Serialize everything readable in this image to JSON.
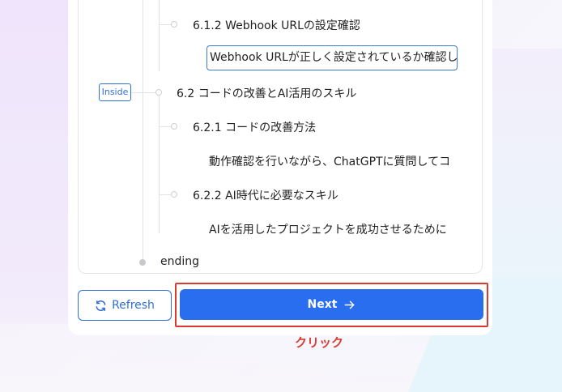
{
  "tree": {
    "nodes": [
      {
        "id": "6-1-2",
        "label": "6.1.2 Webhook URLの設定確認"
      },
      {
        "id": "6-2",
        "label": "6.2 コードの改善とAI活用のスキル"
      },
      {
        "id": "6-2-1",
        "label": "6.2.1 コードの改善方法"
      },
      {
        "id": "6-2-2",
        "label": "6.2.2 AI時代に必要なスキル"
      },
      {
        "id": "ending",
        "label": "ending"
      }
    ],
    "texts": [
      {
        "id": "6-1-2-text",
        "value": "Webhook URLが正しく設定されているか確認し"
      },
      {
        "id": "6-2-1-text",
        "value": "動作確認を行いながら、ChatGPTに質問してコ"
      },
      {
        "id": "6-2-2-text",
        "value": "AIを活用したプロジェクトを成功させるために"
      }
    ],
    "inside_badge": "Inside"
  },
  "buttons": {
    "refresh_label": "Refresh",
    "next_label": "Next"
  },
  "annotation": {
    "click_label": "クリック"
  },
  "colors": {
    "primary": "#2a6ef0",
    "highlight": "#d93a2f"
  },
  "icons": {
    "refresh": "refresh-icon",
    "next": "arrow-right-icon"
  }
}
